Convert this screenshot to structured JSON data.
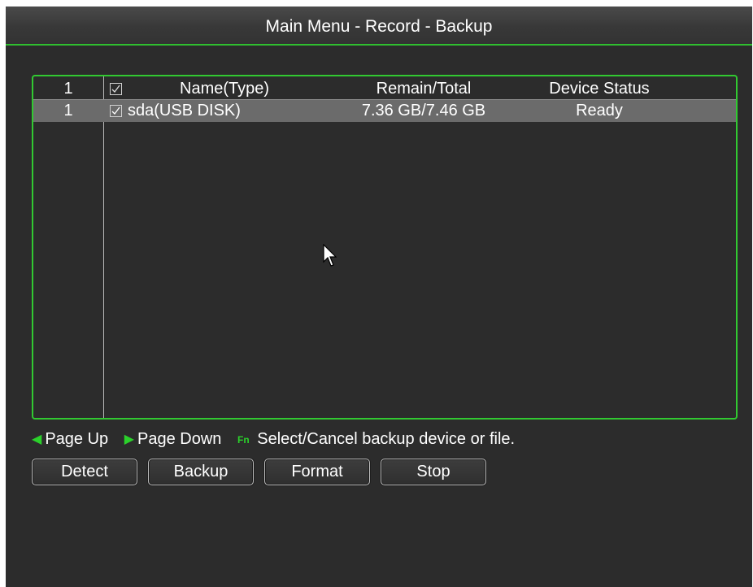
{
  "window": {
    "title": "Main Menu - Record - Backup"
  },
  "table": {
    "header": {
      "num": "1",
      "checked": true,
      "name": "Name(Type)",
      "remain_total": "Remain/Total",
      "status": "Device Status"
    },
    "rows": [
      {
        "num": "1",
        "checked": true,
        "name": "sda(USB DISK)",
        "remain_total": "7.36 GB/7.46 GB",
        "status": "Ready",
        "selected": true
      }
    ]
  },
  "hint": {
    "page_up_icon": "page-up-icon",
    "page_up": "Page Up",
    "page_down_icon": "page-down-icon",
    "page_down": "Page Down",
    "fn_icon": "fn-key-icon",
    "fn_glyph": "Fn",
    "fn_text": "Select/Cancel backup device or file."
  },
  "buttons": {
    "detect": "Detect",
    "backup": "Backup",
    "format": "Format",
    "stop": "Stop"
  },
  "colors": {
    "accent": "#31c931",
    "background": "#2c2c2c",
    "selected_row": "#6b6b6b"
  }
}
